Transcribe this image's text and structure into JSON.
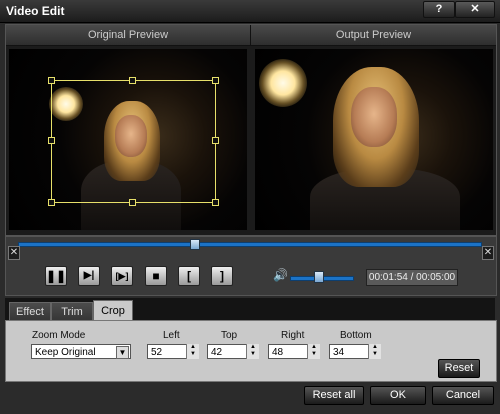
{
  "window": {
    "title": "Video Edit",
    "help_label": "?",
    "close_label": "✕"
  },
  "preview": {
    "original_label": "Original Preview",
    "output_label": "Output Preview"
  },
  "timeline": {
    "progress": 0.38,
    "trim_start_label": "✕",
    "trim_end_label": "✕"
  },
  "controls": {
    "pause_icon": "❚❚",
    "step_icon": "▶|",
    "frame_icon": "[▶]",
    "stop_icon": "■",
    "mark_in_icon": "[",
    "mark_out_icon": "]",
    "volume_icon": "🔊",
    "volume_level": 0.45,
    "time_display": "00:01:54 / 00:05:00"
  },
  "tabs": [
    {
      "label": "Effect"
    },
    {
      "label": "Trim"
    },
    {
      "label": "Crop"
    }
  ],
  "crop": {
    "zoom_mode_label": "Zoom Mode",
    "zoom_mode_value": "Keep Original",
    "left_label": "Left",
    "left_value": "52",
    "top_label": "Top",
    "top_value": "42",
    "right_label": "Right",
    "right_value": "48",
    "bottom_label": "Bottom",
    "bottom_value": "34",
    "reset_label": "Reset"
  },
  "footer": {
    "reset_all_label": "Reset all",
    "ok_label": "OK",
    "cancel_label": "Cancel"
  }
}
